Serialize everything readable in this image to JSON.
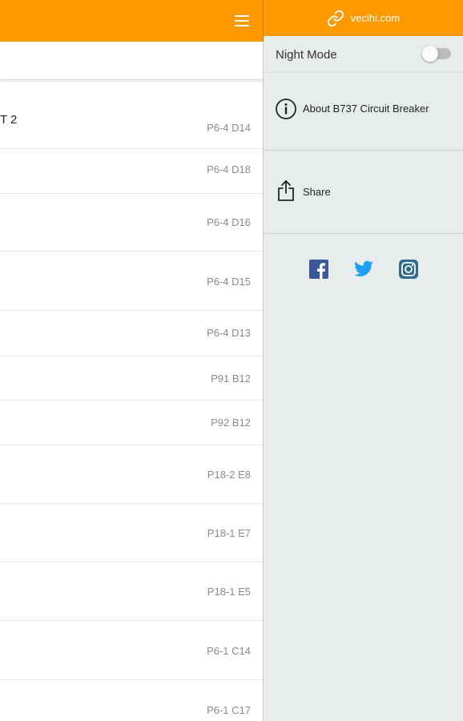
{
  "colors": {
    "accent": "#ff9900",
    "facebook": "#3b5998",
    "twitter": "#1da1f2",
    "instagram": "#2f6a8f"
  },
  "main": {
    "search": {
      "placeholder": ""
    },
    "rows": [
      {
        "title": "T 2",
        "code": "P6-4 D14"
      },
      {
        "title": "",
        "code": "P6-4 D18"
      },
      {
        "title": "",
        "code": "P6-4 D16"
      },
      {
        "title": "",
        "code": "P6-4 D15"
      },
      {
        "title": "",
        "code": "P6-4 D13"
      },
      {
        "title": "",
        "code": "P91 B12"
      },
      {
        "title": "",
        "code": "P92 B12"
      },
      {
        "title": "",
        "code": "P18-2 E8"
      },
      {
        "title": "",
        "code": "P18-1 E7"
      },
      {
        "title": "",
        "code": "P18-1 E5"
      },
      {
        "title": "",
        "code": "P6-1 C14"
      },
      {
        "title": "",
        "code": "P6-1 C17"
      }
    ]
  },
  "drawer": {
    "header_link": "vecihi.com",
    "night_mode_label": "Night Mode",
    "night_mode_on": false,
    "about_label": "About B737 Circuit Breaker",
    "share_label": "Share",
    "social": [
      "facebook-icon",
      "twitter-icon",
      "instagram-icon"
    ]
  }
}
